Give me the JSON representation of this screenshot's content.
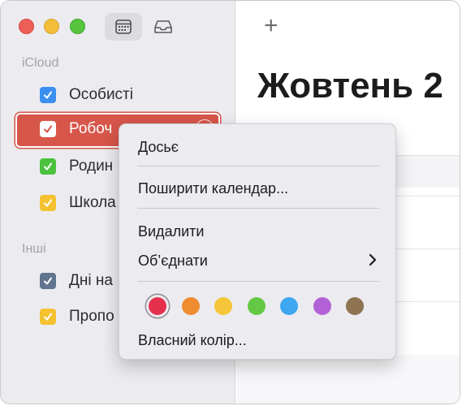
{
  "sidebar": {
    "sections": [
      {
        "label": "iCloud"
      },
      {
        "label": "Інші"
      }
    ],
    "icloud_items": [
      {
        "label": "Особисті",
        "color": "#3a8ff0",
        "checked": true
      },
      {
        "label": "Робоч",
        "color": "#d7564a",
        "checked": true,
        "selected": true
      },
      {
        "label": "Родин",
        "color": "#4bc13e",
        "checked": true
      },
      {
        "label": "Школа",
        "color": "#f4c230",
        "checked": true
      }
    ],
    "other_items": [
      {
        "label": "Дні на",
        "color": "#60738f",
        "checked": true
      },
      {
        "label": "Пропо",
        "color": "#f4c230",
        "checked": true
      }
    ]
  },
  "toolbar": {
    "add_symbol": "+"
  },
  "main": {
    "title": "Жовтень 2"
  },
  "context_menu": {
    "items": [
      {
        "label": "Досьє"
      },
      {
        "label": "Поширити календар..."
      },
      {
        "label": "Видалити"
      },
      {
        "label": "Об’єднати",
        "has_submenu": true
      },
      {
        "label": "Власний колір..."
      }
    ],
    "swatches": [
      {
        "name": "red",
        "color": "#e5304d",
        "selected": true
      },
      {
        "name": "orange",
        "color": "#f08c30"
      },
      {
        "name": "yellow",
        "color": "#f6c63a"
      },
      {
        "name": "green",
        "color": "#63c944"
      },
      {
        "name": "blue",
        "color": "#3da7f1"
      },
      {
        "name": "purple",
        "color": "#b262d6"
      },
      {
        "name": "brown",
        "color": "#8f7452"
      }
    ]
  }
}
